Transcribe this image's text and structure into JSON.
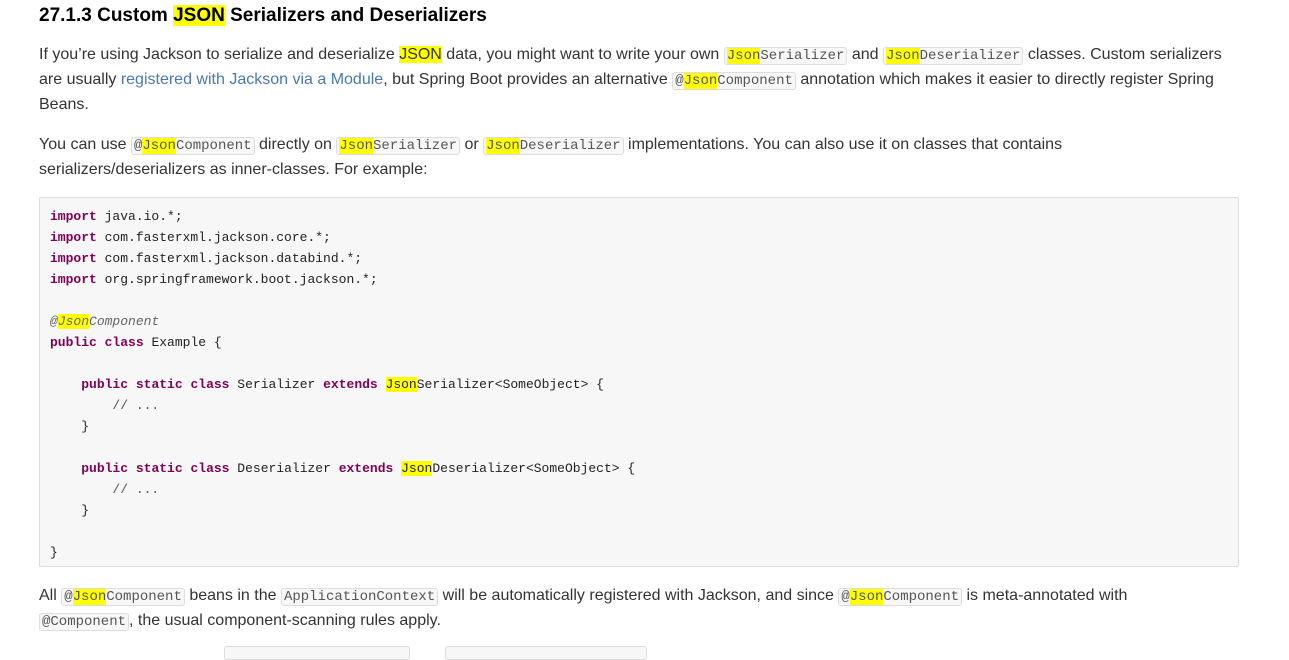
{
  "section": {
    "title_prefix": "27.1.3 Custom ",
    "title_highlight": "JSON",
    "title_suffix": " Serializers and Deserializers"
  },
  "para1": {
    "l1_t1": "If you’re using Jackson to serialize and deserialize ",
    "l1_hl": "JSON",
    "l1_t2": " data, you might want to write your own ",
    "code_serializer_hl": "Json",
    "code_serializer_rest": "Serializer",
    "l1_t3": " and ",
    "code_deserializer_hl": "Json",
    "code_deserializer_rest": "Deserializer",
    "l1_t4": " classes. Custom serializers",
    "l2_t1": "are usually ",
    "link": "registered with Jackson via a Module",
    "l2_t2": ", but Spring Boot provides an alternative ",
    "code_component_at": "@",
    "code_component_hl": "Json",
    "code_component_rest": "Component",
    "l2_t3": " annotation which makes it easier to directly register Spring",
    "l3_t1": "Beans."
  },
  "para2": {
    "l1_t1": "You can use ",
    "code_component_at": "@",
    "code_component_hl": "Json",
    "code_component_rest": "Component",
    "l1_t2": " directly on ",
    "code_serializer_hl": "Json",
    "code_serializer_rest": "Serializer",
    "l1_t3": " or ",
    "code_deserializer_hl": "Json",
    "code_deserializer_rest": "Deserializer",
    "l1_t4": " implementations. You can also use it on classes that contains",
    "l2_t1": "serializers/deserializers as inner-classes. For example:"
  },
  "code": {
    "import_kw": "import",
    "import1": " java.io.*;",
    "import2": " com.fasterxml.jackson.core.*;",
    "import3": " com.fasterxml.jackson.databind.*;",
    "import4": " org.springframework.boot.jackson.*;",
    "ann_at": "@",
    "ann_hl": "Json",
    "ann_rest": "Component",
    "public_kw": "public",
    "class_kw": "class",
    "static_kw": "static",
    "extends_kw": "extends",
    "example_name": " Example {",
    "ser_name": " Serializer ",
    "deser_name": " Deserializer ",
    "json_hl": "Json",
    "ser_type": "Serializer<SomeObject> {",
    "deser_type": "Deserializer<SomeObject> {",
    "comment": "// ...",
    "close_brace": "}"
  },
  "para3": {
    "l1_t1": "All ",
    "code_component_at": "@",
    "code_component_hl": "Json",
    "code_component_rest": "Component",
    "l1_t2": " beans in the ",
    "code_appctx": "ApplicationContext",
    "l1_t3": " will be automatically registered with Jackson, and since ",
    "l1_t4": " is meta-annotated with",
    "code_component_plain": "@Component",
    "l2_t1": ", the usual component-scanning rules apply."
  }
}
